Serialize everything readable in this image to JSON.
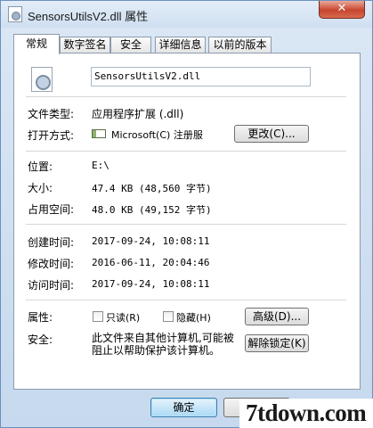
{
  "window": {
    "title": "SensorsUtilsV2.dll 属性",
    "close_glyph": "✕"
  },
  "tabs": [
    {
      "label": "常规",
      "active": true
    },
    {
      "label": "数字签名",
      "active": false
    },
    {
      "label": "安全",
      "active": false
    },
    {
      "label": "详细信息",
      "active": false
    },
    {
      "label": "以前的版本",
      "active": false
    }
  ],
  "general": {
    "file_icon": "dll-file-icon",
    "file_name": "SensorsUtilsV2.dll",
    "file_type_label": "文件类型:",
    "file_type_value": "应用程序扩展 (.dll)",
    "opens_with_label": "打开方式:",
    "opens_with_icon": "app-icon",
    "opens_with_value": "Microsoft(C) 注册服",
    "change_button": "更改(C)...",
    "location_label": "位置:",
    "location_value": "E:\\",
    "size_label": "大小:",
    "size_value": "47.4 KB (48,560 字节)",
    "size_on_disk_label": "占用空间:",
    "size_on_disk_value": "48.0 KB (49,152 字节)",
    "created_label": "创建时间:",
    "created_value": "2017-09-24, 10:08:11",
    "modified_label": "修改时间:",
    "modified_value": "2016-06-11, 20:04:46",
    "accessed_label": "访问时间:",
    "accessed_value": "2017-09-24, 10:08:11",
    "attributes_label": "属性:",
    "readonly_label": "只读(R)",
    "readonly_checked": false,
    "hidden_label": "隐藏(H)",
    "hidden_checked": false,
    "advanced_button": "高级(D)...",
    "security_label": "安全:",
    "security_text": "此文件来自其他计算机,可能被阻止以帮助保护该计算机。",
    "unblock_button": "解除锁定(K)"
  },
  "footer": {
    "ok_button": "确定",
    "cancel_button": ""
  },
  "watermark": {
    "text": "7tdown.com"
  }
}
